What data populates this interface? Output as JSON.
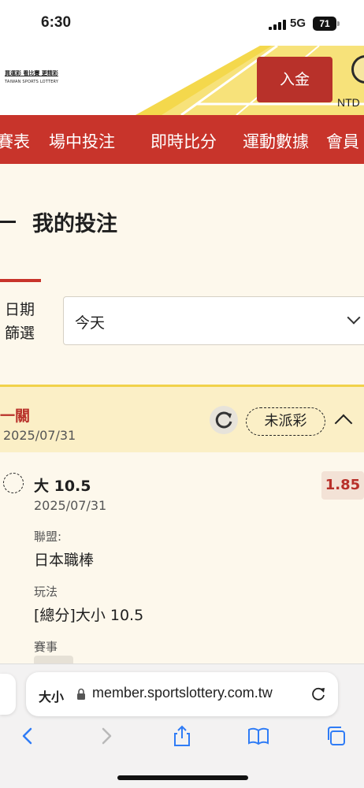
{
  "status_bar": {
    "time": "6:30",
    "network": "5G",
    "battery": "71"
  },
  "header": {
    "logo_zh": "買運彩 看比賽 更精彩",
    "logo_en": "TAIWAN SPORTS LOTTERY",
    "deposit_label": "入金",
    "currency": "NTD"
  },
  "nav": {
    "items": [
      "賽表",
      "場中投注",
      "即時比分",
      "運動數據",
      "會員"
    ]
  },
  "page": {
    "title": "我的投注"
  },
  "filter": {
    "label_line1": "日期",
    "label_line2": "篩選",
    "selected": "今天"
  },
  "bet_card": {
    "type": "一關",
    "date": "2025/07/31",
    "status": "未派彩",
    "selection": "大 10.5",
    "selection_date": "2025/07/31",
    "odds": "1.85",
    "league_label": "聯盟:",
    "league": "日本職棒",
    "play_label": "玩法",
    "play": "[總分]大小 10.5",
    "event_label": "賽事"
  },
  "browser": {
    "text_size_label": "大小",
    "url": "member.sportslottery.com.tw"
  },
  "colors": {
    "brand_red": "#c8342b",
    "card_yellow": "#fbefc6",
    "accent_yellow": "#f1d24a"
  }
}
